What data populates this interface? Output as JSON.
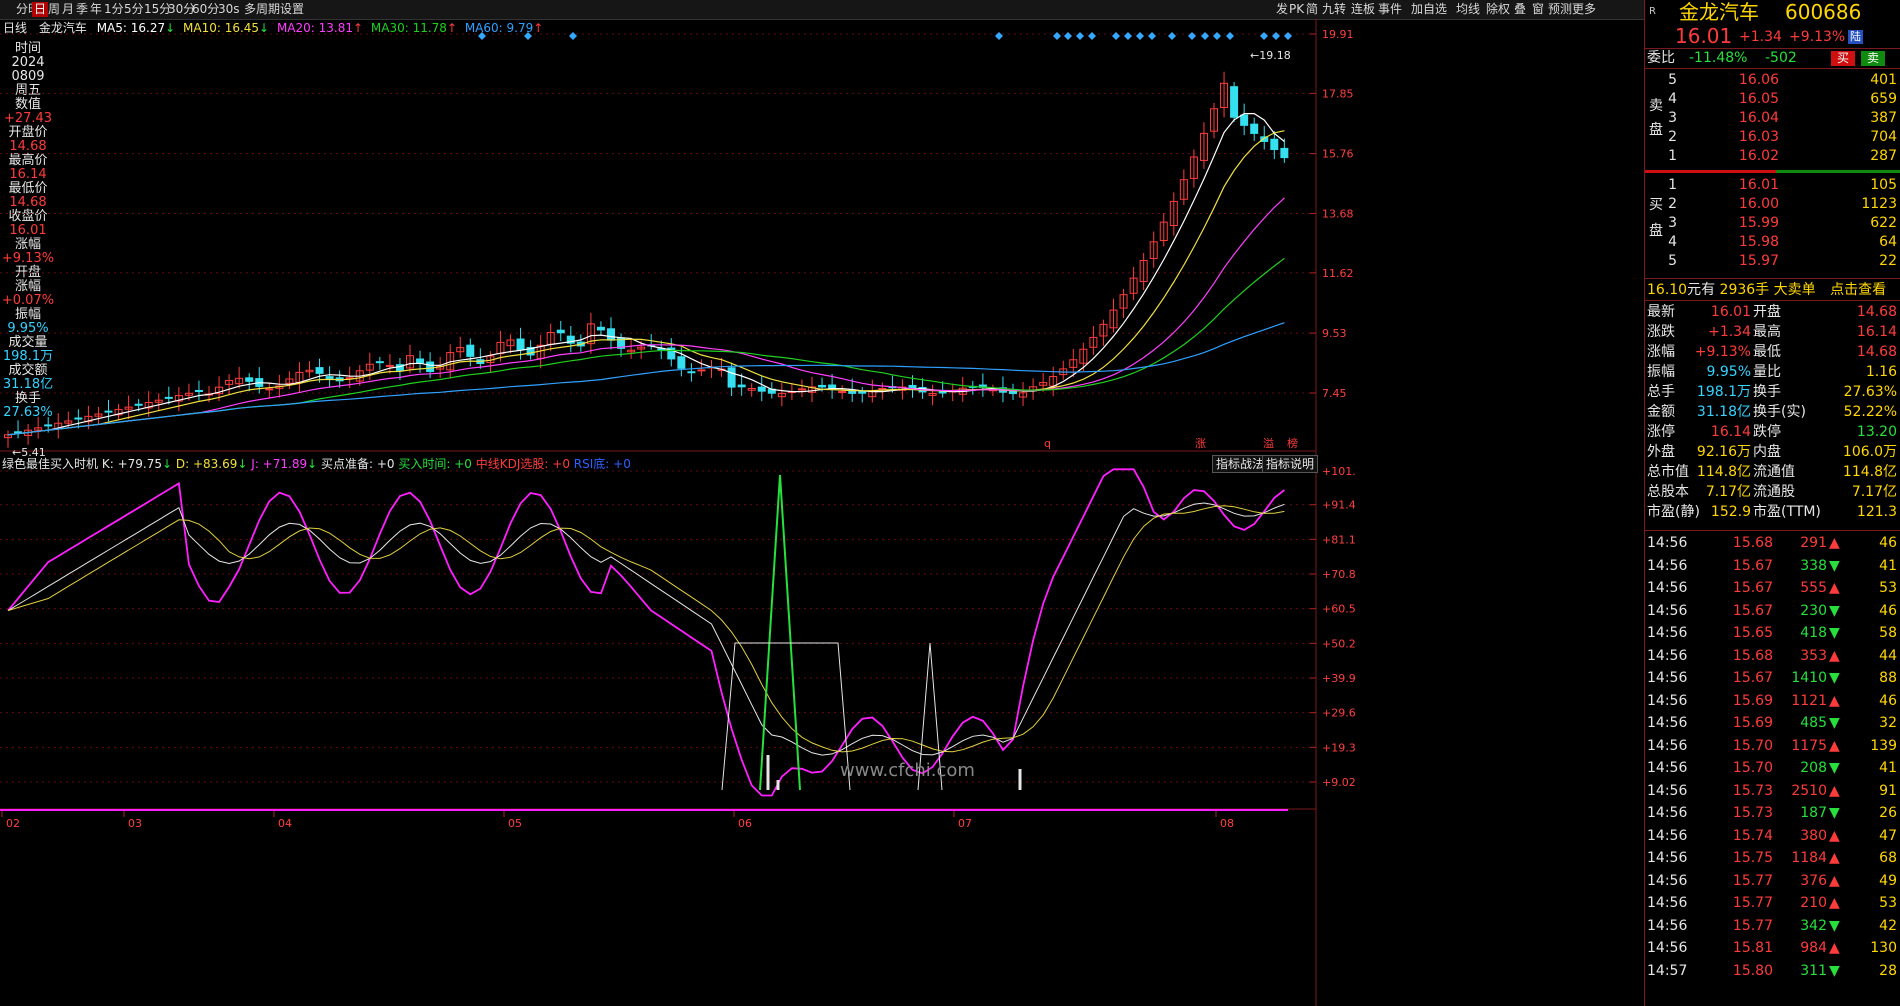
{
  "toolbar": {
    "left": [
      "分时",
      "日",
      "周",
      "月",
      "季",
      "年",
      "1分",
      "5分",
      "15分",
      "30分",
      "60分",
      "30s",
      "多周期",
      "设置"
    ],
    "active_index": 1,
    "right": [
      "发",
      "PK",
      "简",
      "九转",
      "连板",
      "事件",
      "加自选",
      "均线",
      "除权",
      "叠",
      "窗",
      "预测",
      "更多"
    ]
  },
  "ma_line": {
    "period": "日线",
    "name": "金龙汽车",
    "ma5": "MA5: 16.27",
    "ma10": "MA10: 16.45",
    "ma20": "MA20: 13.81",
    "ma30": "MA30: 11.78",
    "ma60": "MA60: 9.79"
  },
  "left_panel": [
    {
      "t": "时间",
      "c": "#e6e6e6"
    },
    {
      "t": "2024",
      "c": "#e6e6e6"
    },
    {
      "t": "0809",
      "c": "#e6e6e6"
    },
    {
      "t": "周五",
      "c": "#e6e6e6"
    },
    {
      "t": "数值",
      "c": "#e6e6e6"
    },
    {
      "t": "+27.43",
      "c": "#ff3c3c"
    },
    {
      "t": "开盘价",
      "c": "#e6e6e6"
    },
    {
      "t": "14.68",
      "c": "#ff3c3c"
    },
    {
      "t": "最高价",
      "c": "#e6e6e6"
    },
    {
      "t": "16.14",
      "c": "#ff3c3c"
    },
    {
      "t": "最低价",
      "c": "#e6e6e6"
    },
    {
      "t": "14.68",
      "c": "#ff3c3c"
    },
    {
      "t": "收盘价",
      "c": "#e6e6e6"
    },
    {
      "t": "16.01",
      "c": "#ff3c3c"
    },
    {
      "t": "涨幅",
      "c": "#e6e6e6"
    },
    {
      "t": "+9.13%",
      "c": "#ff3c3c"
    },
    {
      "t": "开盘",
      "c": "#e6e6e6"
    },
    {
      "t": "涨幅",
      "c": "#e6e6e6"
    },
    {
      "t": "+0.07%",
      "c": "#ff3c3c"
    },
    {
      "t": "振幅",
      "c": "#e6e6e6"
    },
    {
      "t": "9.95%",
      "c": "#35d3ff"
    },
    {
      "t": "成交量",
      "c": "#e6e6e6"
    },
    {
      "t": "198.1万",
      "c": "#35d3ff"
    },
    {
      "t": "成交额",
      "c": "#e6e6e6"
    },
    {
      "t": "31.18亿",
      "c": "#35d3ff"
    },
    {
      "t": "换手",
      "c": "#e6e6e6"
    },
    {
      "t": "27.63%",
      "c": "#35d3ff"
    }
  ],
  "price_axis": [
    "19.91",
    "17.85",
    "15.76",
    "13.68",
    "11.62",
    "9.53",
    "7.45"
  ],
  "price_annot": {
    "high": "19.18",
    "low": "5.41"
  },
  "indicator": {
    "title": "绿色最佳买入时机",
    "k": "K: +79.75",
    "d": "D: +83.69",
    "j": "J: +71.89",
    "buy_ready": "买点准备: +0",
    "buy_time": "买入时间: +0",
    "kdj_pick": "中线KDJ选股: +0",
    "rsi": "RSI底: +0",
    "btn1": "指标战法",
    "btn2": "指标说明",
    "axis": [
      "+101.5",
      "+91.48",
      "+81.18",
      "+70.87",
      "+60.56",
      "+50.25",
      "+39.95",
      "+29.64",
      "+19.33",
      "+9.02"
    ]
  },
  "x_axis": [
    "02",
    "03",
    "04",
    "05",
    "06",
    "07",
    "08"
  ],
  "markers_bottom": [
    {
      "t": "q"
    },
    {
      "t": "涨"
    },
    {
      "t": "溢"
    },
    {
      "t": "榜"
    }
  ],
  "watermark": "www.cfchi.com",
  "stock": {
    "name": "金龙汽车",
    "code": "600686",
    "price": "16.01",
    "change": "+1.34",
    "pct": "+9.13%",
    "tag": "陆",
    "weibi_label": "委比",
    "weibi": "-11.48%",
    "weicha": "-502",
    "buy_btn": "买",
    "sell_btn": "卖"
  },
  "sell_orders": [
    {
      "lvl": "5",
      "price": "16.06",
      "vol": "401"
    },
    {
      "lvl": "4",
      "price": "16.05",
      "vol": "659"
    },
    {
      "lvl": "3",
      "price": "16.04",
      "vol": "387"
    },
    {
      "lvl": "2",
      "price": "16.03",
      "vol": "704"
    },
    {
      "lvl": "1",
      "price": "16.02",
      "vol": "287"
    }
  ],
  "buy_orders": [
    {
      "lvl": "1",
      "price": "16.01",
      "vol": "105"
    },
    {
      "lvl": "2",
      "price": "16.00",
      "vol": "1123"
    },
    {
      "lvl": "3",
      "price": "15.99",
      "vol": "622"
    },
    {
      "lvl": "4",
      "price": "15.98",
      "vol": "64"
    },
    {
      "lvl": "5",
      "price": "15.97",
      "vol": "22"
    }
  ],
  "sell_label": [
    "卖",
    "盘"
  ],
  "buy_label": [
    "买",
    "盘"
  ],
  "big_order": {
    "price": "16.10",
    "unit": "元有",
    "vol": "2936手",
    "text": "大卖单",
    "link": "点击查看"
  },
  "quote": [
    [
      "最新",
      "16.01",
      "开盘",
      "14.68"
    ],
    [
      "涨跌",
      "+1.34",
      "最高",
      "16.14"
    ],
    [
      "涨幅",
      "+9.13%",
      "最低",
      "14.68"
    ],
    [
      "振幅",
      "9.95%",
      "量比",
      "1.16"
    ],
    [
      "总手",
      "198.1万",
      "换手",
      "27.63%"
    ],
    [
      "金额",
      "31.18亿",
      "换手(实)",
      "52.22%"
    ],
    [
      "涨停",
      "16.14",
      "跌停",
      "13.20"
    ],
    [
      "外盘",
      "92.16万",
      "内盘",
      "106.0万"
    ],
    [
      "总市值",
      "114.8亿",
      "流通值",
      "114.8亿"
    ],
    [
      "总股本",
      "7.17亿",
      "流通股",
      "7.17亿"
    ],
    [
      "市盈(静)",
      "152.9",
      "市盈(TTM)",
      "121.3"
    ]
  ],
  "ticks": [
    {
      "t": "14:56",
      "p": "15.68",
      "v": "291",
      "d": "up",
      "n": "46"
    },
    {
      "t": "14:56",
      "p": "15.67",
      "v": "338",
      "d": "down",
      "n": "41"
    },
    {
      "t": "14:56",
      "p": "15.67",
      "v": "555",
      "d": "up",
      "n": "53"
    },
    {
      "t": "14:56",
      "p": "15.67",
      "v": "230",
      "d": "down",
      "n": "46"
    },
    {
      "t": "14:56",
      "p": "15.65",
      "v": "418",
      "d": "down",
      "n": "58"
    },
    {
      "t": "14:56",
      "p": "15.68",
      "v": "353",
      "d": "up",
      "n": "44"
    },
    {
      "t": "14:56",
      "p": "15.67",
      "v": "1410",
      "d": "down",
      "n": "88"
    },
    {
      "t": "14:56",
      "p": "15.69",
      "v": "1121",
      "d": "up",
      "n": "46"
    },
    {
      "t": "14:56",
      "p": "15.69",
      "v": "485",
      "d": "down",
      "n": "32"
    },
    {
      "t": "14:56",
      "p": "15.70",
      "v": "1175",
      "d": "up",
      "n": "139"
    },
    {
      "t": "14:56",
      "p": "15.70",
      "v": "208",
      "d": "down",
      "n": "41"
    },
    {
      "t": "14:56",
      "p": "15.73",
      "v": "2510",
      "d": "up",
      "n": "91"
    },
    {
      "t": "14:56",
      "p": "15.73",
      "v": "187",
      "d": "down",
      "n": "26"
    },
    {
      "t": "14:56",
      "p": "15.74",
      "v": "380",
      "d": "up",
      "n": "47"
    },
    {
      "t": "14:56",
      "p": "15.75",
      "v": "1184",
      "d": "up",
      "n": "68"
    },
    {
      "t": "14:56",
      "p": "15.77",
      "v": "376",
      "d": "up",
      "n": "49"
    },
    {
      "t": "14:56",
      "p": "15.77",
      "v": "210",
      "d": "up",
      "n": "53"
    },
    {
      "t": "14:56",
      "p": "15.77",
      "v": "342",
      "d": "down",
      "n": "42"
    },
    {
      "t": "14:56",
      "p": "15.81",
      "v": "984",
      "d": "up",
      "n": "130"
    },
    {
      "t": "14:57",
      "p": "15.80",
      "v": "311",
      "d": "down",
      "n": "28"
    }
  ],
  "colors": {
    "up": "#ff3c3c",
    "down": "#27e03d",
    "candle_up": "#ff3c3c",
    "candle_down": "#35e0f0",
    "ma5": "#ffffff",
    "ma10": "#f0e040",
    "ma20": "#ff40ff",
    "ma30": "#20d020",
    "ma60": "#30a0ff"
  }
}
